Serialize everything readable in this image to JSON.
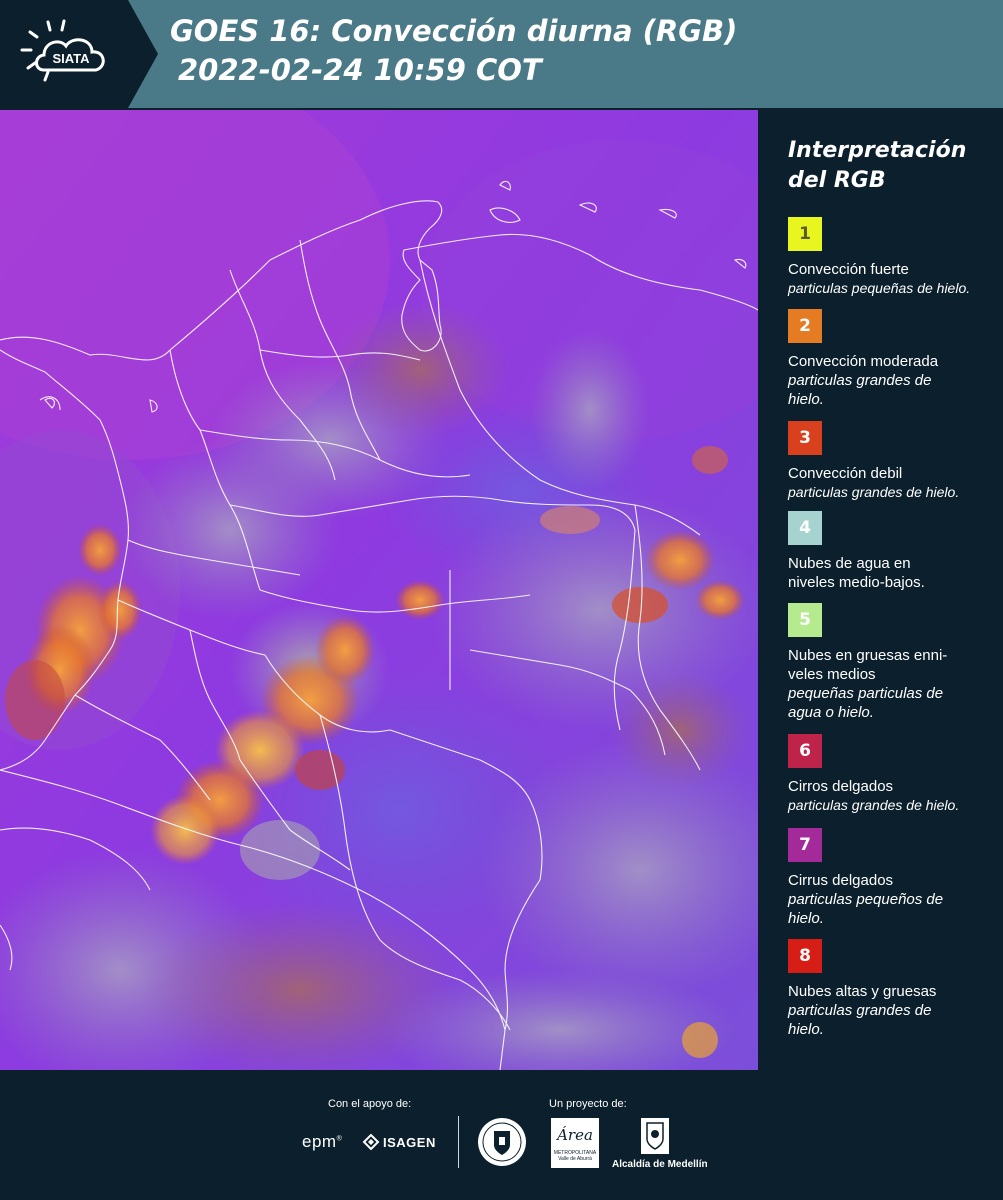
{
  "header": {
    "logo_text": "SIATA",
    "title_line1": "GOES 16: Convección diurna (RGB)",
    "title_line2": "2022-02-24 10:59 COT"
  },
  "legend": {
    "title_line1": "Interpretación",
    "title_line2": "del RGB",
    "items": [
      {
        "number": "1",
        "color": "#e8f51e",
        "text_color": "#5a5a2a",
        "title": "Convección fuerte",
        "desc": "particulas pequeñas de hielo."
      },
      {
        "number": "2",
        "color": "#e57c24",
        "text_color": "#ffffff",
        "title": "Convección moderada",
        "desc": "particulas grandes de hielo."
      },
      {
        "number": "3",
        "color": "#d9401e",
        "text_color": "#ffffff",
        "title": "Convección debil",
        "desc": "particulas grandes de hielo."
      },
      {
        "number": "4",
        "color": "#a6d3cf",
        "text_color": "#ffffff",
        "title": "Nubes de agua en niveles medio-bajos.",
        "desc": ""
      },
      {
        "number": "5",
        "color": "#b6ea8f",
        "text_color": "#ffffff",
        "title": "Nubes en gruesas enni-veles medios",
        "desc": "pequeñas particulas de agua o hielo."
      },
      {
        "number": "6",
        "color": "#c0234a",
        "text_color": "#ffffff",
        "title": "Cirros delgados",
        "desc": "particulas grandes de hielo."
      },
      {
        "number": "7",
        "color": "#a32a98",
        "text_color": "#ffffff",
        "title": "Cirrus delgados",
        "desc": "particulas pequeños de hielo."
      },
      {
        "number": "8",
        "color": "#d61e16",
        "text_color": "#ffffff",
        "title": "Nubes altas y gruesas",
        "desc": "particulas grandes de hielo."
      }
    ]
  },
  "footer": {
    "support_label": "Con el apoyo de:",
    "project_label": "Un proyecto de:",
    "sponsor_epm": "epm",
    "sponsor_isagen": "ISAGEN",
    "partner_area_name": "Área",
    "partner_area_line1": "METROPOLITANA",
    "partner_area_line2": "Valle de Aburrá",
    "partner_alcaldia": "Alcaldía de Medellín"
  }
}
